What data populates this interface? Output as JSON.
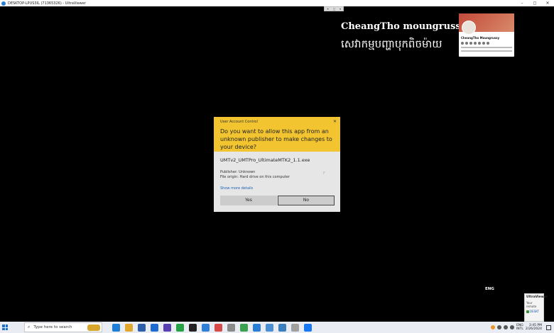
{
  "window": {
    "title": "DESKTOP-LPUS3IL (71365326) - UltraViewer",
    "controls": [
      "–",
      "◻",
      "✕"
    ]
  },
  "mini_toolbar": [
    "✕",
    "◻",
    "▾"
  ],
  "overlay": {
    "name": "CheangTho moungrussy",
    "subtitle": "សេវាកម្មបញ្ហាបុកពិចម៉ាយ"
  },
  "profile_card": {
    "name": "CheangTho Moungrussy"
  },
  "uac": {
    "caption": "User Account Control",
    "close": "✕",
    "question": "Do you want to allow this app from an unknown publisher to make changes to your device?",
    "file_name": "UMTv2_UMTPro_UltimateMTK2_1.1.exe",
    "publisher": "Publisher: Unknown",
    "origin": "File origin: Hard drive on this computer",
    "more_details": "Show more details",
    "yes_label": "Yes",
    "no_label": "No"
  },
  "remote_lang": "ENG",
  "ultraviewer_panel": {
    "title": "UltraViewer",
    "line": "Your remote",
    "status": "DESKT"
  },
  "taskbar": {
    "search_placeholder": "Type here to search",
    "lang_top": "ENG",
    "lang_bottom": "INTL",
    "time": "3:45 PM",
    "date": "2/26/2024",
    "app_colors": [
      "#1f7ed6",
      "#e0a82e",
      "#2e5fa8",
      "#1f6ad1",
      "#5a3fb0",
      "#25a244",
      "#222222",
      "#2f7fd9",
      "#d64a4a",
      "#8a8a8a",
      "#3ba050",
      "#2a7fd4",
      "#4a8fd4",
      "#3c7fbf",
      "#a0a0a0",
      "#1877f2"
    ],
    "colors": {
      "accent": "#1a6fd1"
    }
  }
}
